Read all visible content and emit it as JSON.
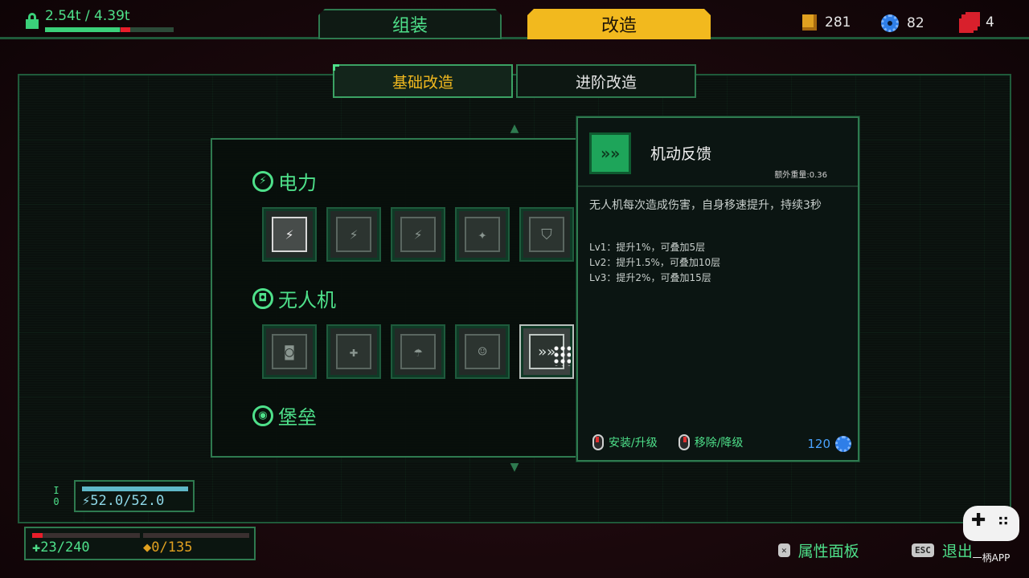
{
  "header": {
    "weight_text": "2.54t / 4.39t",
    "weight_fill": 0.58,
    "tabs": [
      {
        "label": "组装",
        "active": false
      },
      {
        "label": "改造",
        "active": true
      }
    ],
    "resources": {
      "gold": "281",
      "gear": "82",
      "puzzle": "4"
    }
  },
  "subtabs": [
    {
      "label": "基础改造",
      "active": true
    },
    {
      "label": "进阶改造",
      "active": false
    }
  ],
  "categories": [
    {
      "title": "电力",
      "icon": "lightning-icon",
      "icon_glyph": "⚡",
      "slots": [
        {
          "name": "power-mod-1",
          "glyph": "⚡",
          "state": "owned"
        },
        {
          "name": "power-mod-2",
          "glyph": "⚡",
          "state": "locked"
        },
        {
          "name": "power-mod-3",
          "glyph": "⚡",
          "state": "locked"
        },
        {
          "name": "power-mod-4",
          "glyph": "✦",
          "state": "locked"
        },
        {
          "name": "power-mod-5",
          "glyph": "⛉",
          "state": "locked"
        }
      ]
    },
    {
      "title": "无人机",
      "icon": "drone-icon",
      "icon_glyph": "◘",
      "slots": [
        {
          "name": "drone-mod-1",
          "glyph": "◙",
          "state": "locked"
        },
        {
          "name": "drone-mod-2",
          "glyph": "✚",
          "state": "locked"
        },
        {
          "name": "drone-mod-3",
          "glyph": "☂",
          "state": "locked"
        },
        {
          "name": "drone-mod-4",
          "glyph": "☺",
          "state": "locked"
        },
        {
          "name": "drone-mod-5",
          "glyph": "»»",
          "state": "selected"
        }
      ]
    },
    {
      "title": "堡垒",
      "icon": "fortress-icon",
      "icon_glyph": "◉",
      "slots": []
    }
  ],
  "tooltip": {
    "icon": "drone-feedback-icon",
    "icon_glyph": "»»",
    "title": "机动反馈",
    "extra_weight": "额外重量:0.36",
    "description": "无人机每次造成伤害，自身移速提升，持续3秒",
    "levels": [
      "Lv1：提升1%，可叠加5层",
      "Lv2：提升1.5%，可叠加10层",
      "Lv3：提升2%，可叠加15层"
    ],
    "install_label": "安装/升级",
    "remove_label": "移除/降级",
    "cost": "120"
  },
  "stats": {
    "counter_label": "I",
    "counter_value": "0",
    "energy": "52.0/52.0",
    "hp": "23/240",
    "hp_fill": 0.096,
    "shield": "0/135"
  },
  "hints": {
    "attributes_key": "✕",
    "attributes_label": "属性面板",
    "exit_key": "ESC",
    "exit_label": "退出"
  },
  "watermark": {
    "text": "一柄APP"
  },
  "colors": {
    "accent_green": "#4ee08a",
    "accent_gold": "#f2b91e",
    "accent_red": "#e81e2a",
    "accent_blue": "#2e7ee8"
  }
}
